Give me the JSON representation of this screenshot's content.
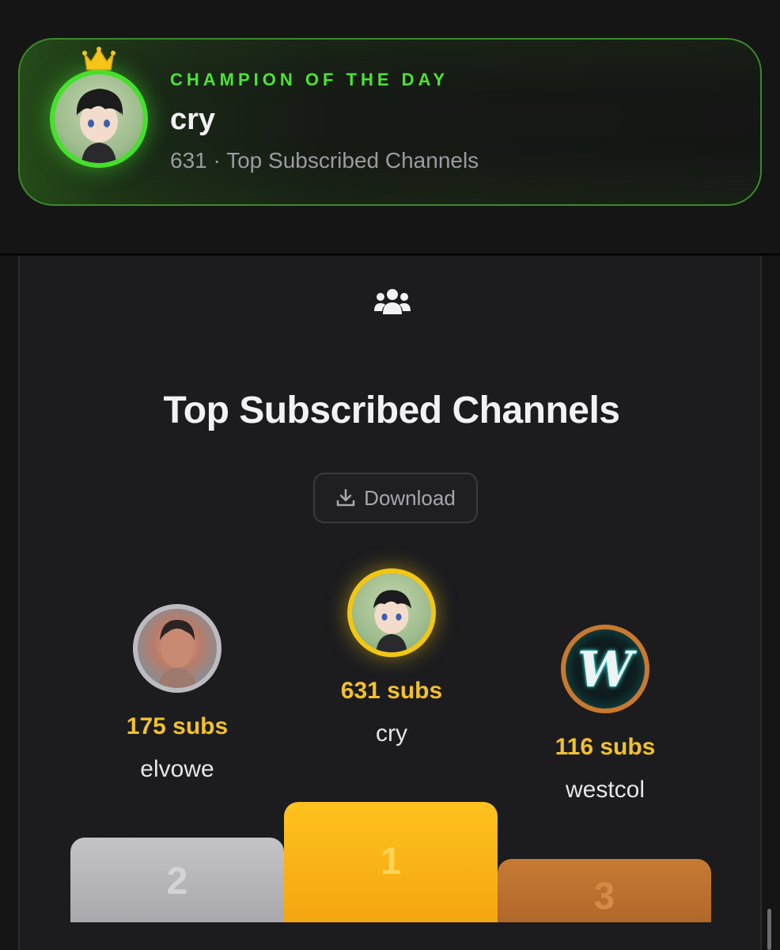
{
  "champion": {
    "label": "CHAMPION OF THE DAY",
    "name": "cry",
    "subtitle": "631 · Top Subscribed Channels",
    "accent_color": "#45e02c",
    "crown_icon": "crown-icon",
    "avatar_desc": "avatar"
  },
  "leaderboard": {
    "icon": "users-icon",
    "title": "Top Subscribed Channels",
    "download_label": "Download",
    "download_icon": "download-icon",
    "podium": [
      {
        "rank": "2",
        "subs": "175 subs",
        "name": "elvowe",
        "ring_color": "#bcbcc0"
      },
      {
        "rank": "1",
        "subs": "631 subs",
        "name": "cry",
        "ring_color": "#f3c613"
      },
      {
        "rank": "3",
        "subs": "116 subs",
        "name": "westcol",
        "ring_color": "#c9792f",
        "logo_letter": "W"
      }
    ],
    "subs_color": "#f2c12c"
  }
}
